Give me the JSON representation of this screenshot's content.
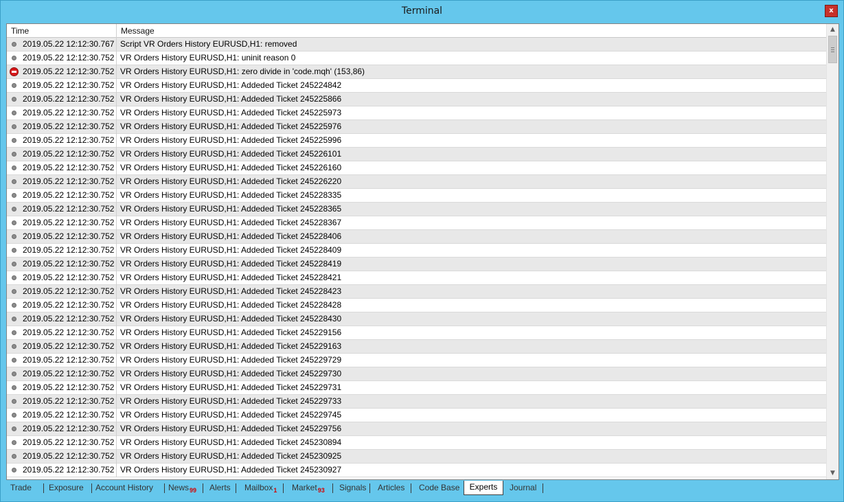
{
  "window": {
    "title": "Terminal",
    "close_label": "x"
  },
  "table": {
    "columns": {
      "time": "Time",
      "message": "Message"
    },
    "rows": [
      {
        "time": "2019.05.22 12:12:30.767",
        "message": "Script VR Orders History EURUSD,H1: removed",
        "icon": "dot-icon"
      },
      {
        "time": "2019.05.22 12:12:30.752",
        "message": "VR Orders History EURUSD,H1: uninit reason 0",
        "icon": "dot-icon"
      },
      {
        "time": "2019.05.22 12:12:30.752",
        "message": "VR Orders History EURUSD,H1: zero divide in 'code.mqh' (153,86)",
        "icon": "error-icon"
      },
      {
        "time": "2019.05.22 12:12:30.752",
        "message": "VR Orders History EURUSD,H1: Addeded Ticket 245224842",
        "icon": "dot-icon"
      },
      {
        "time": "2019.05.22 12:12:30.752",
        "message": "VR Orders History EURUSD,H1: Addeded Ticket 245225866",
        "icon": "dot-icon"
      },
      {
        "time": "2019.05.22 12:12:30.752",
        "message": "VR Orders History EURUSD,H1: Addeded Ticket 245225973",
        "icon": "dot-icon"
      },
      {
        "time": "2019.05.22 12:12:30.752",
        "message": "VR Orders History EURUSD,H1: Addeded Ticket 245225976",
        "icon": "dot-icon"
      },
      {
        "time": "2019.05.22 12:12:30.752",
        "message": "VR Orders History EURUSD,H1: Addeded Ticket 245225996",
        "icon": "dot-icon"
      },
      {
        "time": "2019.05.22 12:12:30.752",
        "message": "VR Orders History EURUSD,H1: Addeded Ticket 245226101",
        "icon": "dot-icon"
      },
      {
        "time": "2019.05.22 12:12:30.752",
        "message": "VR Orders History EURUSD,H1: Addeded Ticket 245226160",
        "icon": "dot-icon"
      },
      {
        "time": "2019.05.22 12:12:30.752",
        "message": "VR Orders History EURUSD,H1: Addeded Ticket 245226220",
        "icon": "dot-icon"
      },
      {
        "time": "2019.05.22 12:12:30.752",
        "message": "VR Orders History EURUSD,H1: Addeded Ticket 245228335",
        "icon": "dot-icon"
      },
      {
        "time": "2019.05.22 12:12:30.752",
        "message": "VR Orders History EURUSD,H1: Addeded Ticket 245228365",
        "icon": "dot-icon"
      },
      {
        "time": "2019.05.22 12:12:30.752",
        "message": "VR Orders History EURUSD,H1: Addeded Ticket 245228367",
        "icon": "dot-icon"
      },
      {
        "time": "2019.05.22 12:12:30.752",
        "message": "VR Orders History EURUSD,H1: Addeded Ticket 245228406",
        "icon": "dot-icon"
      },
      {
        "time": "2019.05.22 12:12:30.752",
        "message": "VR Orders History EURUSD,H1: Addeded Ticket 245228409",
        "icon": "dot-icon"
      },
      {
        "time": "2019.05.22 12:12:30.752",
        "message": "VR Orders History EURUSD,H1: Addeded Ticket 245228419",
        "icon": "dot-icon"
      },
      {
        "time": "2019.05.22 12:12:30.752",
        "message": "VR Orders History EURUSD,H1: Addeded Ticket 245228421",
        "icon": "dot-icon"
      },
      {
        "time": "2019.05.22 12:12:30.752",
        "message": "VR Orders History EURUSD,H1: Addeded Ticket 245228423",
        "icon": "dot-icon"
      },
      {
        "time": "2019.05.22 12:12:30.752",
        "message": "VR Orders History EURUSD,H1: Addeded Ticket 245228428",
        "icon": "dot-icon"
      },
      {
        "time": "2019.05.22 12:12:30.752",
        "message": "VR Orders History EURUSD,H1: Addeded Ticket 245228430",
        "icon": "dot-icon"
      },
      {
        "time": "2019.05.22 12:12:30.752",
        "message": "VR Orders History EURUSD,H1: Addeded Ticket 245229156",
        "icon": "dot-icon"
      },
      {
        "time": "2019.05.22 12:12:30.752",
        "message": "VR Orders History EURUSD,H1: Addeded Ticket 245229163",
        "icon": "dot-icon"
      },
      {
        "time": "2019.05.22 12:12:30.752",
        "message": "VR Orders History EURUSD,H1: Addeded Ticket 245229729",
        "icon": "dot-icon"
      },
      {
        "time": "2019.05.22 12:12:30.752",
        "message": "VR Orders History EURUSD,H1: Addeded Ticket 245229730",
        "icon": "dot-icon"
      },
      {
        "time": "2019.05.22 12:12:30.752",
        "message": "VR Orders History EURUSD,H1: Addeded Ticket 245229731",
        "icon": "dot-icon"
      },
      {
        "time": "2019.05.22 12:12:30.752",
        "message": "VR Orders History EURUSD,H1: Addeded Ticket 245229733",
        "icon": "dot-icon"
      },
      {
        "time": "2019.05.22 12:12:30.752",
        "message": "VR Orders History EURUSD,H1: Addeded Ticket 245229745",
        "icon": "dot-icon"
      },
      {
        "time": "2019.05.22 12:12:30.752",
        "message": "VR Orders History EURUSD,H1: Addeded Ticket 245229756",
        "icon": "dot-icon"
      },
      {
        "time": "2019.05.22 12:12:30.752",
        "message": "VR Orders History EURUSD,H1: Addeded Ticket 245230894",
        "icon": "dot-icon"
      },
      {
        "time": "2019.05.22 12:12:30.752",
        "message": "VR Orders History EURUSD,H1: Addeded Ticket 245230925",
        "icon": "dot-icon"
      },
      {
        "time": "2019.05.22 12:12:30.752",
        "message": "VR Orders History EURUSD,H1: Addeded Ticket 245230927",
        "icon": "dot-icon"
      }
    ]
  },
  "tabs": [
    {
      "label": "Trade",
      "badge": ""
    },
    {
      "label": "Exposure",
      "badge": ""
    },
    {
      "label": "Account History",
      "badge": ""
    },
    {
      "label": "News",
      "badge": "99"
    },
    {
      "label": "Alerts",
      "badge": ""
    },
    {
      "label": "Mailbox",
      "badge": "1"
    },
    {
      "label": "Market",
      "badge": "93"
    },
    {
      "label": "Signals",
      "badge": ""
    },
    {
      "label": "Articles",
      "badge": ""
    },
    {
      "label": "Code Base",
      "badge": ""
    },
    {
      "label": "Experts",
      "badge": "",
      "active": true
    },
    {
      "label": "Journal",
      "badge": ""
    }
  ],
  "colors": {
    "frame": "#65c7ec",
    "close": "#c7312a",
    "row_alt": "#e8e8e8",
    "badge": "#d40000",
    "error": "#d8191b"
  }
}
